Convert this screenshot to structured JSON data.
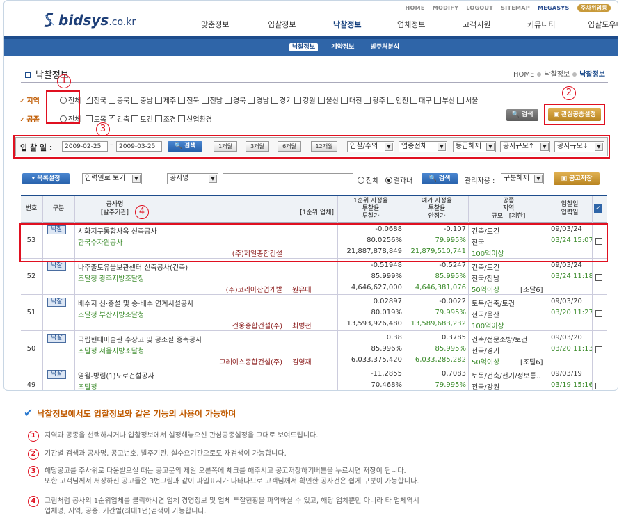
{
  "util": [
    "HOME",
    "MODIFY",
    "LOGOUT",
    "SITEMAP",
    "MEGASYS",
    "주차위임등"
  ],
  "logo": {
    "main": "bidsys",
    "domain": ".co.kr"
  },
  "gnb": [
    "맞춤정보",
    "입찰정보",
    "낙찰정보",
    "업체정보",
    "고객지원",
    "커뮤니티",
    "입찰도우미"
  ],
  "subnav": [
    "낙찰정보",
    "계약정보",
    "발주처분석"
  ],
  "page_title": "낙찰정보",
  "breadcrumb": [
    "HOME",
    "낙찰정보",
    "낙찰정보"
  ],
  "region": {
    "label": "지역",
    "all": "전체",
    "items": [
      "전국",
      "충북",
      "충남",
      "제주",
      "전북",
      "전남",
      "경북",
      "경남",
      "경기",
      "강원",
      "울산",
      "대전",
      "광주",
      "인천",
      "대구",
      "부산",
      "서울"
    ]
  },
  "work": {
    "label": "공종",
    "all": "전체",
    "items": [
      "토목",
      "건축",
      "토건",
      "조경",
      "산업환경"
    ]
  },
  "buttons": {
    "search": "검색",
    "interest": "관심공종설정",
    "list_setting": "목록설정",
    "search2": "검색",
    "save_notice": "공고저장"
  },
  "daterow": {
    "label": "입 찰 일 :",
    "from": "2009-02-25",
    "to": "2009-03-25",
    "periods": [
      "1개월",
      "3개월",
      "6개월",
      "12개월"
    ],
    "selects": [
      "입찰/수의",
      "업종전체",
      "등급해제",
      "공사규모↑",
      "공사규모↓"
    ]
  },
  "searchbar": {
    "view": "입력일로 보기",
    "field": "공사명",
    "radio_all": "전체",
    "radio_result": "결과내",
    "manage_label": "관리자용 :",
    "manage_value": "구분해제"
  },
  "thead": {
    "no": "번호",
    "type": "구분",
    "name": "공사명",
    "org": "[발주기관]",
    "first": "[1순위 업체]",
    "c1": [
      "1순위 사정율",
      "투찰율",
      "투찰가"
    ],
    "c2": [
      "예가 사정율",
      "투찰율",
      "안정가"
    ],
    "c3": [
      "공종",
      "지역",
      "규모 · [제한]"
    ],
    "c4": [
      "입찰일",
      "입력일"
    ]
  },
  "rows": [
    {
      "no": "53",
      "type": "낙찰",
      "name": "시화지구통합사옥 신축공사",
      "org": "한국수자원공사",
      "company": "(주)제일종합건설",
      "person": "",
      "r1": "-0.0688",
      "r2": "80.0256%",
      "r3": "21,887,878,849",
      "e1": "-0.107",
      "e2": "79.995%",
      "e3": "21,879,510,741",
      "g1": "건축/토건",
      "g2": "전국",
      "g3": "100억이상",
      "g3b": "",
      "d1": "09/03/24",
      "d2": "03/24 15:07"
    },
    {
      "no": "52",
      "type": "낙찰",
      "name": "나주출토유물보관센터 신축공사(건축)",
      "org": "조달청 광주지방조달청",
      "company": "(주)코리아산업개발",
      "person": "원유태",
      "r1": "-0.51948",
      "r2": "85.999%",
      "r3": "4,646,627,000",
      "e1": "-0.5247",
      "e2": "85.995%",
      "e3": "4,646,381,076",
      "g1": "건축/토건",
      "g2": "전국/전남",
      "g3": "50억이상",
      "g3b": "[조달6]",
      "d1": "09/03/24",
      "d2": "03/24 11:18"
    },
    {
      "no": "51",
      "type": "낙찰",
      "name": "배수지 신·증설 및 송·배수 연계시설공사",
      "org": "조달청 부산지방조달청",
      "company": "건웅종합건설(주)",
      "person": "최병천",
      "r1": "0.02897",
      "r2": "80.019%",
      "r3": "13,593,926,480",
      "e1": "-0.0022",
      "e2": "79.995%",
      "e3": "13,589,683,232",
      "g1": "토목/건축/토건",
      "g2": "전국/울산",
      "g3": "100억이상",
      "g3b": "",
      "d1": "09/03/20",
      "d2": "03/20 11:27"
    },
    {
      "no": "50",
      "type": "낙찰",
      "name": "국립현대미술관 수장고 및 공조실 증축공사",
      "org": "조달청 서울지방조달청",
      "company": "그레이스종합건설(주)",
      "person": "김영재",
      "r1": "0.38",
      "r2": "85.996%",
      "r3": "6,033,375,420",
      "e1": "0.3785",
      "e2": "85.995%",
      "e3": "6,033,285,282",
      "g1": "건축/전문소방/토건",
      "g2": "전국/경기",
      "g3": "50억이상",
      "g3b": "[조달6]",
      "d1": "09/03/20",
      "d2": "03/20 11:13"
    },
    {
      "no": "49",
      "type": "낙찰",
      "name": "영월-방림(1)도로건설공사",
      "org": "조달청",
      "company": "",
      "person": "",
      "r1": "-11.2855",
      "r2": "70.468%",
      "r3": "",
      "e1": "0.7083",
      "e2": "79.995%",
      "e3": "",
      "g1": "토목/건축/전기/정보통..",
      "g2": "전국/강원",
      "g3": "",
      "g3b": "",
      "d1": "09/03/19",
      "d2": "03/19 15:16"
    }
  ],
  "notes": {
    "title": "낙찰정보에서도 입찰정보와 같은 기능의 사용이 가능하며",
    "items": [
      {
        "n": "1",
        "lines": [
          "지역과 공종을 선택하시거나 입찰정보에서 설정해놓으신 관심공종설정을 그대로 보여드립니다."
        ]
      },
      {
        "n": "2",
        "lines": [
          "기간별 검색과 공사명, 공고번호, 발주기관, 실수요기관으로도 재검색이 가능합니다."
        ]
      },
      {
        "n": "3",
        "lines": [
          "해당공고를 주사위로 다운받으실 때는 공고문의 제일 오른쪽에 체크를 해주시고 공고저장하기버튼을 누르시면 저장이 됩니다.",
          "또한 고객님께서 저장하신 공고들은 3번그림과 같이 파일표시가 나타나므로 고객님께서 확인한 공사건은 쉽게 구분이 가능합니다."
        ]
      },
      {
        "n": "4",
        "lines": [
          "그림처럼 공사의 1순위업체를 클릭하시면 업체 경영정보 및 업체 투찰현황을 파악하실 수 있고, 해당 업체뿐만 아니라 타 업체역시",
          "업체명, 지역, 공종, 기간별(최대1년)검색이 가능합니다."
        ]
      }
    ]
  },
  "markers": [
    "1",
    "2",
    "3",
    "4"
  ]
}
